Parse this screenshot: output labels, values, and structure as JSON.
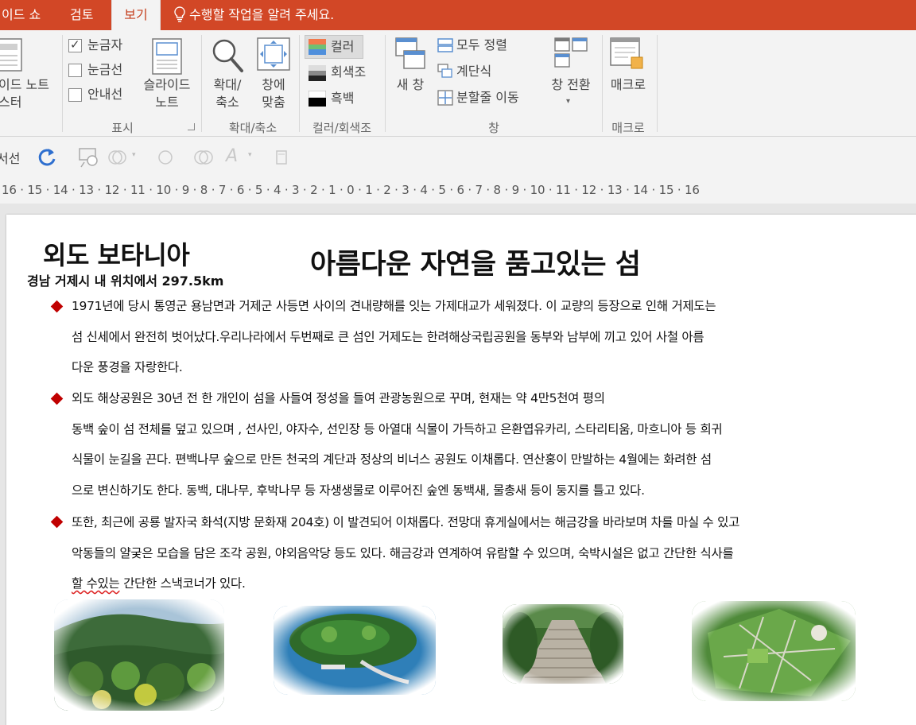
{
  "tabs": {
    "slideshow": "이드 쇼",
    "review": "검토",
    "view": "보기",
    "tell_me": "수행할 작업을 알려 주세요."
  },
  "ribbon": {
    "master": {
      "line1": "이드 노트",
      "line2": "스터"
    },
    "show": {
      "ruler": "눈금자",
      "gridlines": "눈금선",
      "guides": "안내선",
      "ruler_checked": true,
      "gridlines_checked": false,
      "guides_checked": false,
      "notes_line1": "슬라이드",
      "notes_line2": "노트",
      "label": "표시"
    },
    "zoom": {
      "zoom_line1": "확대/",
      "zoom_line2": "축소",
      "fit_line1": "창에",
      "fit_line2": "맞춤",
      "label": "확대/축소"
    },
    "color": {
      "color": "컬러",
      "grayscale": "회색조",
      "bw": "흑백",
      "label": "컬러/회색조"
    },
    "window": {
      "new_window": "새 창",
      "arrange_all": "모두 정렬",
      "cascade": "계단식",
      "move_split": "분할줄 이동",
      "switch_line1": "창 전환",
      "label": "창"
    },
    "macros": {
      "macros": "매크로",
      "label": "매크로"
    }
  },
  "quickbar": {
    "text": "서선"
  },
  "ruler": "16 · 15 · 14 · 13 · 12 · 11 · 10 · 9 · 8 · 7 · 6 · 5 · 4 · 3 · 2 · 1 · 0 · 1 · 2 · 3 · 4 · 5 · 6 · 7 · 8 · 9 · 10 · 11 · 12 · 13 · 14 · 15 · 16",
  "slide": {
    "title_left": "외도 보타니아",
    "title_sub": "경남 거제시 내 위치에서 297.5km",
    "title_main": "아름다운 자연을 품고있는 섬",
    "p1": [
      "1971년에 당시 통영군 용남면과 거제군 사등면 사이의 견내량해를 잇는 가제대교가 세워졌다. 이 교량의 등장으로 인해 거제도는",
      "섬 신세에서 완전히 벗어났다.우리나라에서 두번째로 큰 섬인 거제도는 한려해상국립공원을 동부와 남부에 끼고 있어 사철 아름",
      "다운 풍경을 자랑한다."
    ],
    "p2": [
      "외도 해상공원은 30년 전 한 개인이 섬을 사들여 정성을 들여 관광농원으로 꾸며, 현재는 약 4만5천여 평의",
      "동백 숲이 섬 전체를 덮고 있으며 , 선사인, 야자수, 선인장 등 아열대 식물이 가득하고 은환엽유카리, 스타리티움, 마흐니아 등 희귀",
      "식물이 눈길을 끈다. 편백나무 숲으로 만든 천국의 계단과 정상의 비너스 공원도 이채롭다. 연산홍이 만발하는 4월에는 화려한 섬",
      "으로 변신하기도 한다. 동백, 대나무, 후박나무 등 자생생물로 이루어진  숲엔 동백새, 물총새 등이 둥지를 틀고 있다."
    ],
    "p3": [
      "또한, 최근에 공룡 발자국 화석(지방 문화재 204호) 이 발견되어 이채롭다. 전망대 휴게실에서는 해금강을 바라보며 차를 마실 수 있고",
      "악동들의 얄궂은 모습을 담은 조각 공원, 야외음악당 등도 있다. 해금강과 연계하여 유람할 수 있으며, 숙박시설은 없고 간단한 식사를"
    ],
    "p3_last_underlined": "할 수있는",
    "p3_last_rest": " 간단한 스낵코너가 있다."
  }
}
